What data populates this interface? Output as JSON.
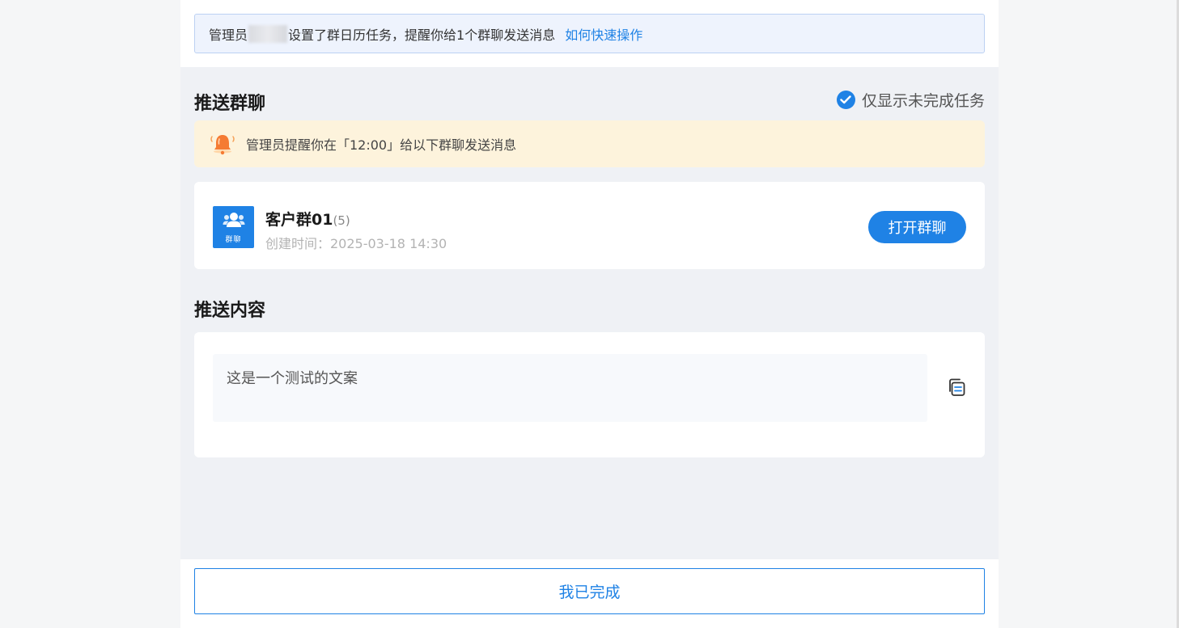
{
  "notice": {
    "prefix": "管理员",
    "suffix": "设置了群日历任务，提醒你给1个群聊发送消息",
    "link": "如何快速操作"
  },
  "push_group": {
    "title": "推送群聊",
    "filter_label": "仅显示未完成任务",
    "reminder": "管理员提醒你在「12:00」给以下群聊发送消息",
    "group": {
      "avatar_tag": "群聊",
      "name": "客户群01",
      "count": "(5)",
      "created": "创建时间：2025-03-18 14:30",
      "open_button": "打开群聊"
    }
  },
  "push_content": {
    "title": "推送内容",
    "text": "这是一个测试的文案"
  },
  "done_button": "我已完成",
  "colors": {
    "accent": "#1f82e5",
    "notice_bg": "#eef3fd",
    "reminder_bg": "#fdf3dc",
    "panel_bg": "#eff1f5"
  },
  "icons": [
    "check-circle-icon",
    "bell-icon",
    "group-users-icon",
    "copy-icon"
  ]
}
